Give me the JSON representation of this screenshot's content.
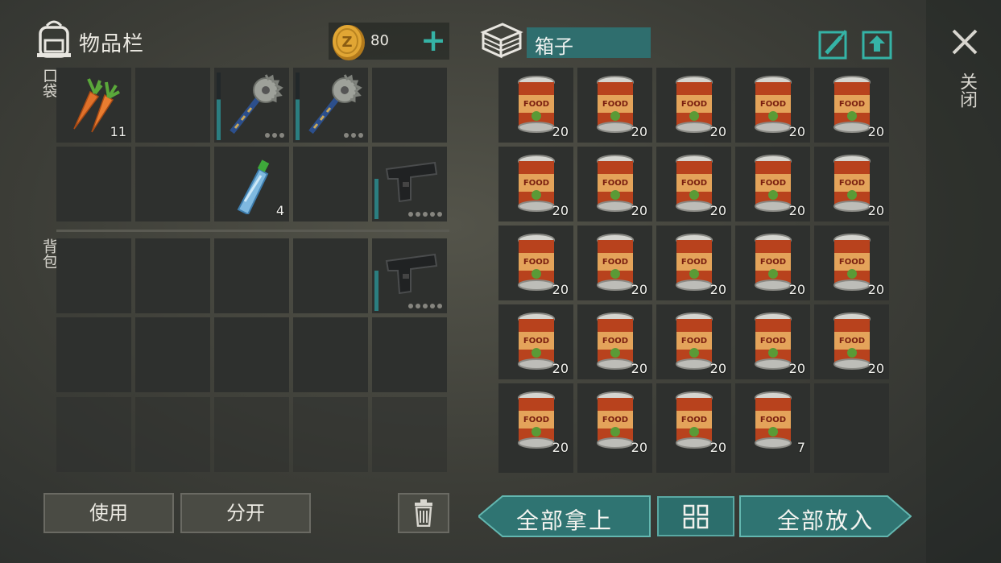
{
  "inventory": {
    "title": "物品栏",
    "coins": "80",
    "add_label": "+",
    "pocket_label": "口袋",
    "backpack_label": "背包",
    "pocket_slots": [
      {
        "item": "carrot-icon",
        "count": "11"
      },
      {
        "item": "",
        "count": ""
      },
      {
        "item": "sawblade-club-icon",
        "count": "",
        "durability": true
      },
      {
        "item": "sawblade-club-icon",
        "count": "",
        "durability": true
      },
      {
        "item": "",
        "count": ""
      },
      {
        "item": "",
        "count": ""
      },
      {
        "item": "",
        "count": ""
      },
      {
        "item": "water-bottle-icon",
        "count": "4"
      },
      {
        "item": "",
        "count": ""
      },
      {
        "item": "pistol-icon",
        "count": "",
        "durability": true
      }
    ],
    "backpack_slots": [
      {
        "item": "",
        "count": ""
      },
      {
        "item": "",
        "count": ""
      },
      {
        "item": "",
        "count": ""
      },
      {
        "item": "",
        "count": ""
      },
      {
        "item": "pistol-icon",
        "count": "",
        "durability": true
      },
      {
        "item": "",
        "count": ""
      },
      {
        "item": "",
        "count": ""
      },
      {
        "item": "",
        "count": ""
      },
      {
        "item": "",
        "count": ""
      },
      {
        "item": "",
        "count": ""
      }
    ]
  },
  "container": {
    "name": "箱子",
    "slots": [
      {
        "item": "food-can-icon",
        "count": "20"
      },
      {
        "item": "food-can-icon",
        "count": "20"
      },
      {
        "item": "food-can-icon",
        "count": "20"
      },
      {
        "item": "food-can-icon",
        "count": "20"
      },
      {
        "item": "food-can-icon",
        "count": "20"
      },
      {
        "item": "food-can-icon",
        "count": "20"
      },
      {
        "item": "food-can-icon",
        "count": "20"
      },
      {
        "item": "food-can-icon",
        "count": "20"
      },
      {
        "item": "food-can-icon",
        "count": "20"
      },
      {
        "item": "food-can-icon",
        "count": "20"
      },
      {
        "item": "food-can-icon",
        "count": "20"
      },
      {
        "item": "food-can-icon",
        "count": "20"
      },
      {
        "item": "food-can-icon",
        "count": "20"
      },
      {
        "item": "food-can-icon",
        "count": "20"
      },
      {
        "item": "food-can-icon",
        "count": "20"
      },
      {
        "item": "food-can-icon",
        "count": "20"
      },
      {
        "item": "food-can-icon",
        "count": "20"
      },
      {
        "item": "food-can-icon",
        "count": "20"
      },
      {
        "item": "food-can-icon",
        "count": "20"
      },
      {
        "item": "food-can-icon",
        "count": "20"
      },
      {
        "item": "food-can-icon",
        "count": "20"
      },
      {
        "item": "food-can-icon",
        "count": "20"
      },
      {
        "item": "food-can-icon",
        "count": "20"
      },
      {
        "item": "food-can-icon",
        "count": "7"
      },
      {
        "item": "",
        "count": ""
      }
    ],
    "can_label": "FOOD"
  },
  "buttons": {
    "use": "使用",
    "split": "分开",
    "take_all": "全部拿上",
    "put_all": "全部放入",
    "close": "关闭"
  },
  "colors": {
    "accent": "#35b3a6",
    "slot_bg": "#2e302e",
    "teal_button": "#2c6e6c"
  }
}
